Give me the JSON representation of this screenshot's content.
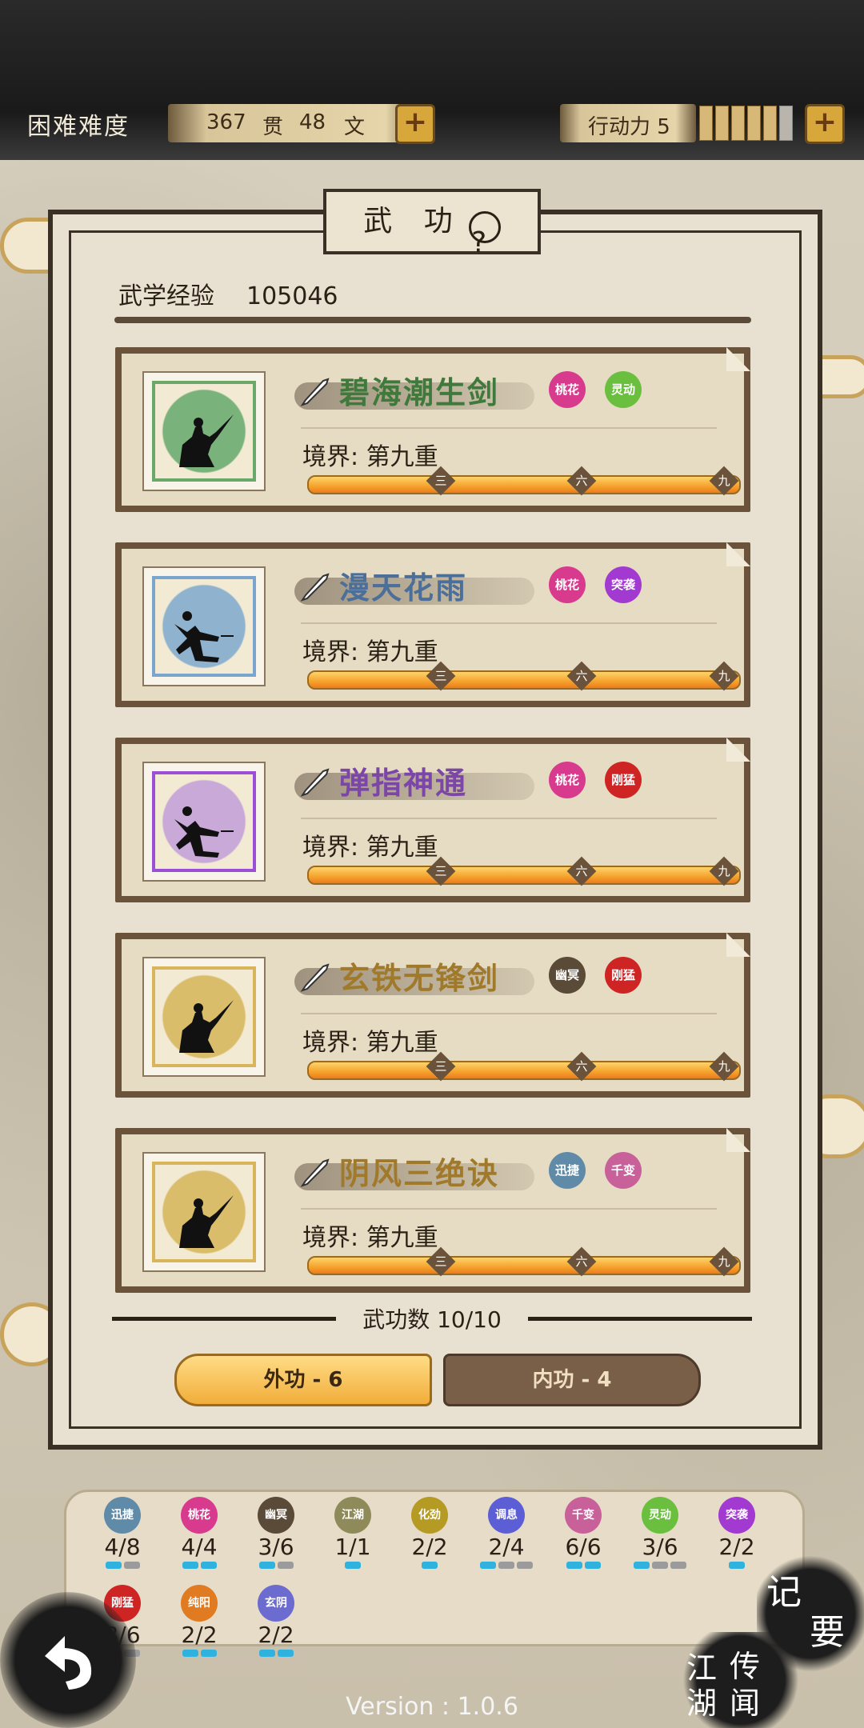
{
  "header": {
    "difficulty": "困难难度",
    "money": {
      "guan_value": "367",
      "guan_unit": "贯",
      "wen_value": "48",
      "wen_unit": "文"
    },
    "action_label": "行动力 5",
    "action_pips_filled": 5,
    "action_pips_total": 6
  },
  "panel": {
    "title": "武 功",
    "help_glyph": "?",
    "exp_label": "武学经验",
    "exp_value": "105046"
  },
  "skills": [
    {
      "name": "碧海潮生剑",
      "name_color": "#3f7a3c",
      "realm": "境界: 第九重",
      "portrait_color": "#79b27a",
      "border_color": "#6aa86a",
      "tags": [
        {
          "label": "桃花",
          "color": "#d83a8d"
        },
        {
          "label": "灵动",
          "color": "#6bbf3e"
        }
      ],
      "weapon": "sword"
    },
    {
      "name": "漫天花雨",
      "name_color": "#4b6f99",
      "realm": "境界: 第九重",
      "portrait_color": "#8fb3cf",
      "border_color": "#7aa6cd",
      "tags": [
        {
          "label": "桃花",
          "color": "#d83a8d"
        },
        {
          "label": "突袭",
          "color": "#a23ad1"
        }
      ],
      "weapon": "dart"
    },
    {
      "name": "弹指神通",
      "name_color": "#7c45a8",
      "realm": "境界: 第九重",
      "portrait_color": "#c8a9d8",
      "border_color": "#9a4fd6",
      "tags": [
        {
          "label": "桃花",
          "color": "#d83a8d"
        },
        {
          "label": "刚猛",
          "color": "#cf2424"
        }
      ],
      "weapon": "dart"
    },
    {
      "name": "玄铁无锋剑",
      "name_color": "#a07a2a",
      "realm": "境界: 第九重",
      "portrait_color": "#d9bd6a",
      "border_color": "#d8b45a",
      "tags": [
        {
          "label": "幽冥",
          "color": "#5a4a38"
        },
        {
          "label": "刚猛",
          "color": "#cf2424"
        }
      ],
      "weapon": "sword"
    },
    {
      "name": "阴风三绝诀",
      "name_color": "#a07a2a",
      "realm": "境界: 第九重",
      "portrait_color": "#d9bd6a",
      "border_color": "#d8b45a",
      "tags": [
        {
          "label": "迅捷",
          "color": "#5f8aa8"
        },
        {
          "label": "千变",
          "color": "#c8609a"
        }
      ],
      "weapon": "sword"
    }
  ],
  "progress_marks": [
    "三",
    "六",
    "九"
  ],
  "progress_fraction": 1.0,
  "skill_count_label": "武功数 10/10",
  "tabs": {
    "outer": "外功 - 6",
    "inner": "内功 - 4"
  },
  "attributes": [
    {
      "label": "迅捷",
      "value": "4/8",
      "color": "#5f8aa8",
      "on": 1,
      "total": 2
    },
    {
      "label": "桃花",
      "value": "4/4",
      "color": "#d83a8d",
      "on": 2,
      "total": 2
    },
    {
      "label": "幽冥",
      "value": "3/6",
      "color": "#5a4a38",
      "on": 1,
      "total": 2
    },
    {
      "label": "江湖",
      "value": "1/1",
      "color": "#8f8a5a",
      "on": 1,
      "total": 1
    },
    {
      "label": "化劲",
      "value": "2/2",
      "color": "#b59a24",
      "on": 1,
      "total": 1
    },
    {
      "label": "调息",
      "value": "2/4",
      "color": "#5c5ed6",
      "on": 1,
      "total": 3
    },
    {
      "label": "千变",
      "value": "6/6",
      "color": "#c8609a",
      "on": 2,
      "total": 2
    },
    {
      "label": "灵动",
      "value": "3/6",
      "color": "#6bbf3e",
      "on": 1,
      "total": 3
    },
    {
      "label": "突袭",
      "value": "2/2",
      "color": "#a23ad1",
      "on": 1,
      "total": 1
    },
    {
      "label": "刚猛",
      "value": "3/6",
      "color": "#cf2424",
      "on": 1,
      "total": 2
    },
    {
      "label": "纯阳",
      "value": "2/2",
      "color": "#e07b22",
      "on": 2,
      "total": 2
    },
    {
      "label": "玄阴",
      "value": "2/2",
      "color": "#6b6bd0",
      "on": 2,
      "total": 2
    }
  ],
  "corner_buttons": {
    "memo": [
      "记",
      "要"
    ],
    "rumor": [
      "江",
      "湖",
      "传",
      "闻"
    ]
  },
  "version": "Version : 1.0.6"
}
